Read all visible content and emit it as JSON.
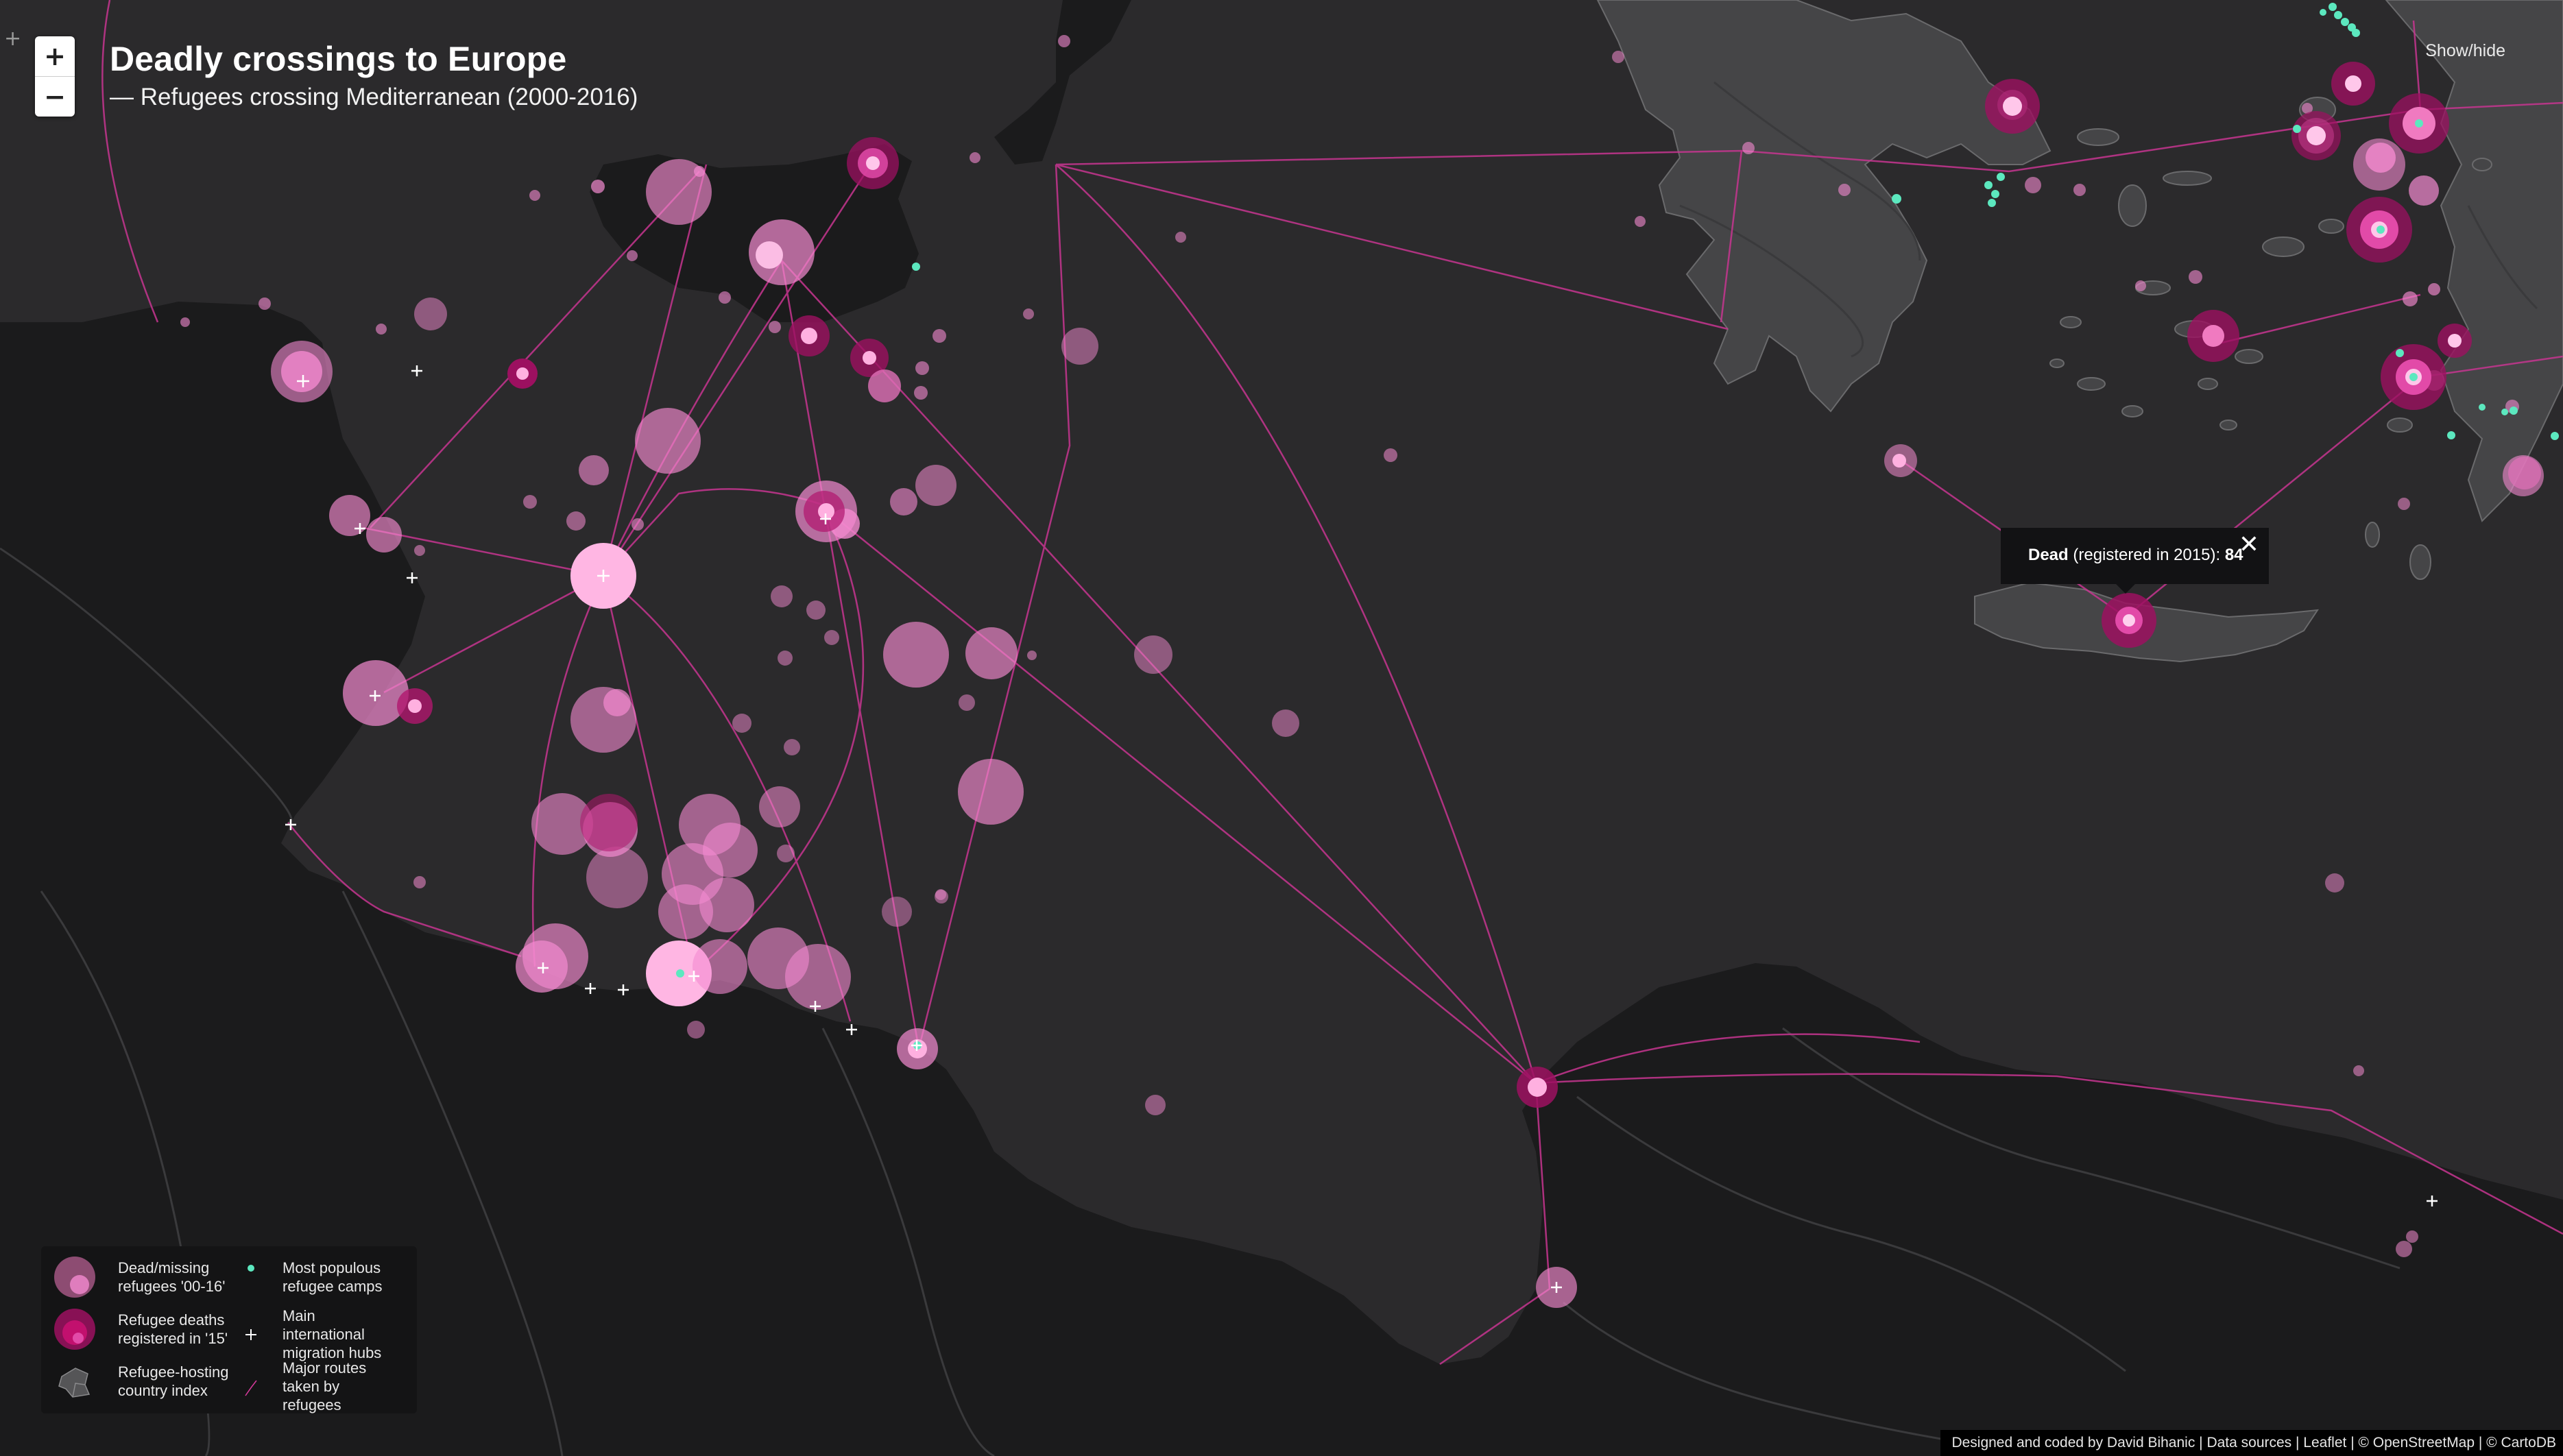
{
  "title": "Deadly crossings to Europe",
  "subtitle": "— Refugees crossing Mediterranean (2000-2016)",
  "zoom": {
    "in_label": "+",
    "out_label": "−"
  },
  "corner_cross": "+",
  "show_hide_label": "Show/hide",
  "tooltip": {
    "label_bold": "Dead",
    "label_rest": " (registered in 2015): ",
    "value": "84",
    "close_label": "✕"
  },
  "legend": {
    "items": [
      {
        "label": "Dead/missing refugees '00-16'",
        "symbol": "dead-missing-circles-icon"
      },
      {
        "label": "Most populous refugee camps",
        "symbol": "camp-dot-icon"
      },
      {
        "label": "Refugee deaths registered in '15'",
        "symbol": "death-2015-circles-icon"
      },
      {
        "label": "Main international migration hubs",
        "symbol": "hub-cross-icon"
      },
      {
        "label": "Refugee-hosting country index",
        "symbol": "country-index-icon"
      },
      {
        "label": "Major routes taken by refugees",
        "symbol": "route-line-icon"
      }
    ]
  },
  "attribution": "Designed and coded by David Bihanic | Data sources | Leaflet | © OpenStreetMap | © CartoDB",
  "colors": {
    "sea": "#2b2a2c",
    "land": "#1b1b1c",
    "greece_land": "#454547",
    "dead_missing": "#f07ac0",
    "death_2015": "#c2106e",
    "camp": "#5ce8bf",
    "route": "#d83a9c",
    "hub": "#ffffff"
  }
}
